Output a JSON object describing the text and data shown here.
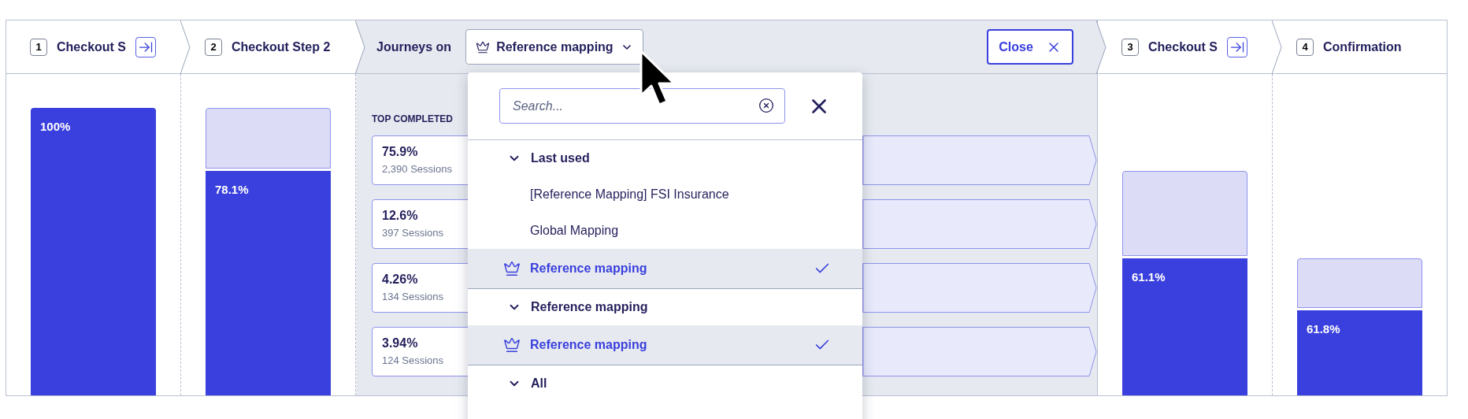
{
  "steps_before": [
    {
      "number": "1",
      "title": "Checkout S",
      "jump_button": true,
      "bar": {
        "label": "100%",
        "level": 1
      }
    },
    {
      "number": "2",
      "title": "Checkout Step 2",
      "jump_button": false,
      "bar": {
        "label": "78.1%",
        "level": 0.781
      }
    }
  ],
  "journeys": {
    "label": "Journeys on",
    "selector": {
      "label": "Reference mapping"
    },
    "close": "Close",
    "section_title": "TOP COMPLETED",
    "paths": [
      {
        "percent": "75.9%",
        "sessions": "2,390 Sessions"
      },
      {
        "percent": "12.6%",
        "sessions": "397 Sessions"
      },
      {
        "percent": "4.26%",
        "sessions": "134 Sessions"
      },
      {
        "percent": "3.94%",
        "sessions": "124 Sessions"
      }
    ]
  },
  "dropdown": {
    "search": {
      "placeholder": "Search..."
    },
    "groups": [
      {
        "title": "Last used",
        "expanded": true,
        "items": [
          {
            "label": "[Reference Mapping] FSI Insurance",
            "kind": "plain",
            "selected": false
          },
          {
            "label": "Global Mapping",
            "kind": "plain",
            "selected": false
          },
          {
            "label": "Reference mapping",
            "kind": "crown",
            "selected": true
          }
        ]
      },
      {
        "title": "Reference mapping",
        "expanded": true,
        "items": [
          {
            "label": "Reference mapping",
            "kind": "crown",
            "selected": true
          }
        ]
      },
      {
        "title": "All",
        "expanded": true
      }
    ]
  },
  "steps_after": [
    {
      "number": "3",
      "title": "Checkout S",
      "jump_button": true,
      "bar": {
        "label": "61.1%",
        "level": 0.477
      }
    },
    {
      "number": "4",
      "title": "Confirmation",
      "jump_button": false,
      "bar": {
        "label": "61.8%",
        "level": 0.295
      }
    }
  ]
}
